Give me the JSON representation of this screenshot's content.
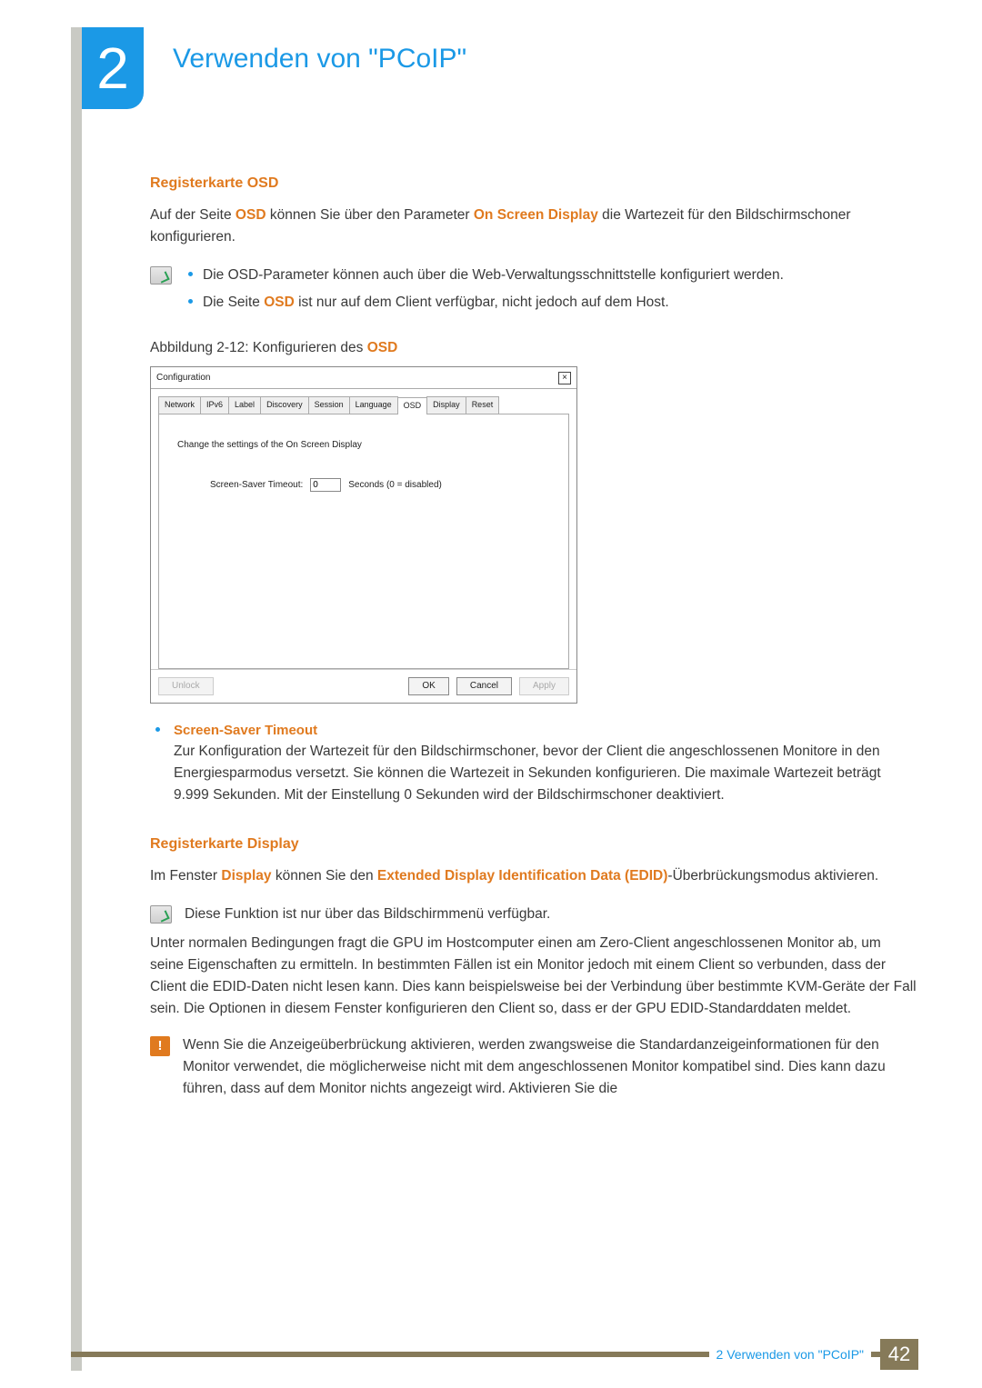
{
  "chapter": {
    "number": "2",
    "title": "Verwenden von \"PCoIP\""
  },
  "section_osd": {
    "heading": "Registerkarte OSD",
    "intro_pre": "Auf der Seite ",
    "intro_bold1": "OSD",
    "intro_mid": " können Sie über den Parameter ",
    "intro_bold2": "On Screen Display",
    "intro_post": " die Wartezeit für den Bildschirmschoner konfigurieren.",
    "notes": [
      "Die OSD-Parameter können auch über die Web-Verwaltungsschnittstelle konfiguriert werden.",
      "Die Seite OSD ist nur auf dem Client verfügbar, nicht jedoch auf dem Host."
    ],
    "note1_pre": "Die Seite ",
    "note1_bold": "OSD",
    "note1_post": " ist nur auf dem Client verfügbar, nicht jedoch auf dem Host.",
    "fig_caption_pre": "Abbildung 2-12: Konfigurieren des ",
    "fig_caption_bold": "OSD"
  },
  "config_window": {
    "title": "Configuration",
    "tabs": [
      "Network",
      "IPv6",
      "Label",
      "Discovery",
      "Session",
      "Language",
      "OSD",
      "Display",
      "Reset"
    ],
    "active_tab": "OSD",
    "body_heading": "Change the settings of the On Screen Display",
    "field_label": "Screen-Saver Timeout:",
    "field_value": "0",
    "field_suffix": "Seconds (0 = disabled)",
    "buttons": {
      "unlock": "Unlock",
      "ok": "OK",
      "cancel": "Cancel",
      "apply": "Apply"
    }
  },
  "screen_saver_def": {
    "term": "Screen-Saver Timeout",
    "body": "Zur Konfiguration der Wartezeit für den Bildschirmschoner, bevor der Client die angeschlossenen Monitore in den Energiesparmodus versetzt. Sie können die Wartezeit in Sekunden konfigurieren. Die maximale Wartezeit beträgt 9.999 Sekunden. Mit der Einstellung 0 Sekunden wird der Bildschirmschoner deaktiviert."
  },
  "section_display": {
    "heading": "Registerkarte Display",
    "p1_pre": "Im Fenster ",
    "p1_b1": "Display",
    "p1_mid": " können Sie den ",
    "p1_b2": "Extended Display Identification Data (EDID)",
    "p1_post": "-Überbrückungsmodus aktivieren.",
    "note": "Diese Funktion ist nur über das Bildschirmmenü verfügbar.",
    "p2": "Unter normalen Bedingungen fragt die GPU im Hostcomputer einen am Zero-Client angeschlossenen Monitor ab, um seine Eigenschaften zu ermitteln. In bestimmten Fällen ist ein Monitor jedoch mit einem Client so verbunden, dass der Client die EDID-Daten nicht lesen kann. Dies kann beispielsweise bei der Verbindung über bestimmte KVM-Geräte der Fall sein. Die Optionen in diesem Fenster konfigurieren den Client so, dass er der GPU EDID-Standarddaten meldet.",
    "warning": "Wenn Sie die Anzeigeüberbrückung aktivieren, werden zwangsweise die Standardanzeigeinformationen für den Monitor verwendet, die möglicherweise nicht mit dem angeschlossenen Monitor kompatibel sind. Dies kann dazu führen, dass auf dem Monitor nichts angezeigt wird. Aktivieren Sie die"
  },
  "footer": {
    "label": "2 Verwenden von \"PCoIP\"",
    "page": "42"
  }
}
